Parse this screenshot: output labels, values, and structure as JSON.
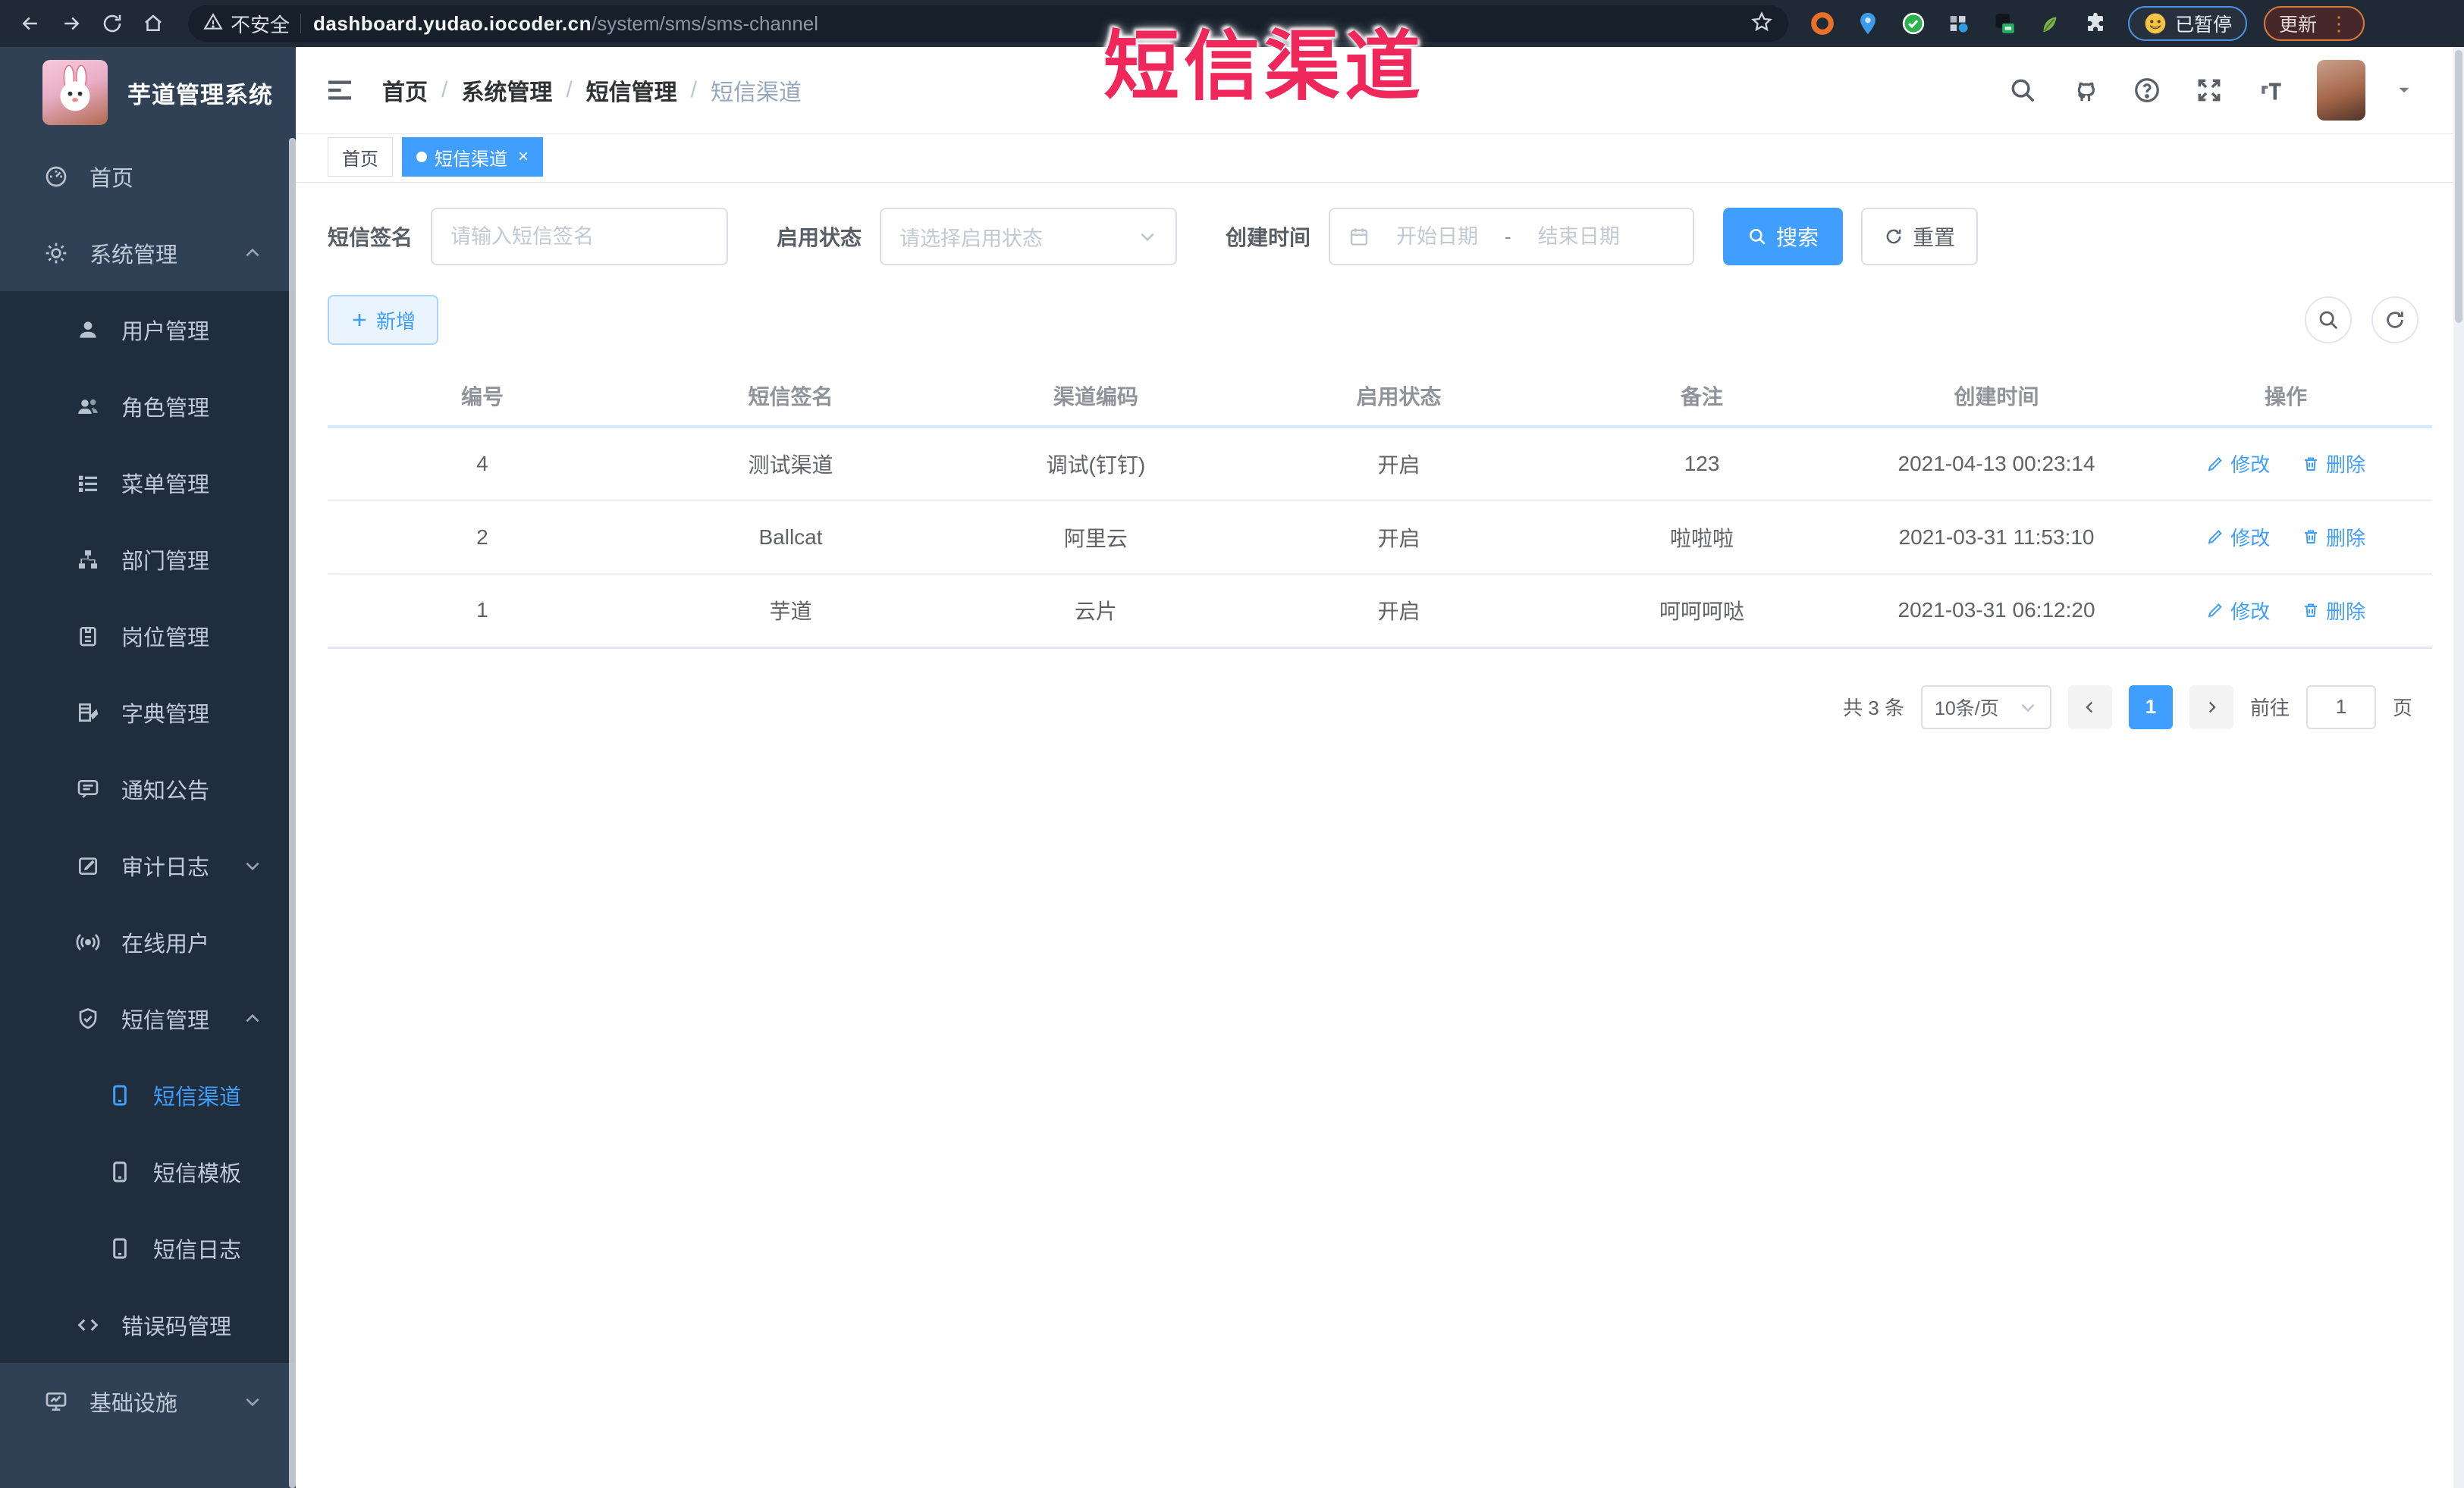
{
  "overlay": {
    "title": "短信渠道"
  },
  "browser": {
    "security_label": "不安全",
    "url_domain": "dashboard.yudao.iocoder.cn",
    "url_path": "/system/sms/sms-channel",
    "paused_label": "已暂停",
    "update_label": "更新",
    "menu_dots": "⋮"
  },
  "sidebar": {
    "logo_title": "芋道管理系统",
    "items": [
      {
        "label": "首页"
      },
      {
        "label": "系统管理",
        "expanded": true
      },
      {
        "label": "用户管理"
      },
      {
        "label": "角色管理"
      },
      {
        "label": "菜单管理"
      },
      {
        "label": "部门管理"
      },
      {
        "label": "岗位管理"
      },
      {
        "label": "字典管理"
      },
      {
        "label": "通知公告"
      },
      {
        "label": "审计日志",
        "expanded": false
      },
      {
        "label": "在线用户"
      },
      {
        "label": "短信管理",
        "expanded": true
      },
      {
        "label": "短信渠道",
        "active": true
      },
      {
        "label": "短信模板"
      },
      {
        "label": "短信日志"
      },
      {
        "label": "错误码管理"
      },
      {
        "label": "基础设施",
        "expanded": false
      }
    ]
  },
  "navbar": {
    "separator": "/",
    "breadcrumbs": [
      "首页",
      "系统管理",
      "短信管理",
      "短信渠道"
    ]
  },
  "tabs": [
    {
      "label": "首页",
      "active": false
    },
    {
      "label": "短信渠道",
      "active": true,
      "close_glyph": "×"
    }
  ],
  "filters": {
    "sign_label": "短信签名",
    "sign_placeholder": "请输入短信签名",
    "status_label": "启用状态",
    "status_placeholder": "请选择启用状态",
    "time_label": "创建时间",
    "date_start_placeholder": "开始日期",
    "date_separator": "-",
    "date_end_placeholder": "结束日期",
    "search_label": "搜索",
    "reset_label": "重置"
  },
  "toolbar": {
    "add_label": "新增"
  },
  "table": {
    "headers": [
      "编号",
      "短信签名",
      "渠道编码",
      "启用状态",
      "备注",
      "创建时间",
      "操作"
    ],
    "rows": [
      {
        "id": "4",
        "sign": "测试渠道",
        "code": "调试(钉钉)",
        "status": "开启",
        "remark": "123",
        "created": "2021-04-13 00:23:14"
      },
      {
        "id": "2",
        "sign": "Ballcat",
        "code": "阿里云",
        "status": "开启",
        "remark": "啦啦啦",
        "created": "2021-03-31 11:53:10"
      },
      {
        "id": "1",
        "sign": "芋道",
        "code": "云片",
        "status": "开启",
        "remark": "呵呵呵哒",
        "created": "2021-03-31 06:12:20"
      }
    ],
    "actions": {
      "edit": "修改",
      "delete": "删除"
    }
  },
  "pagination": {
    "total": "共 3 条",
    "page_size": "10条/页",
    "current_page": "1",
    "goto_label": "前往",
    "goto_value": "1",
    "page_unit": "页"
  },
  "colors": {
    "accent": "#409eff",
    "sidebar_bg": "#304156",
    "submenu_bg": "#1f2d3d",
    "chrome_bg": "#202a36",
    "overlay_red": "#f0275a",
    "header_divider": "#d2e9fa"
  },
  "icons": [
    "back-icon",
    "forward-icon",
    "reload-icon",
    "home-icon",
    "warning-icon",
    "star-icon",
    "extensions-puzzle-icon",
    "emoji-face-icon",
    "hamburger-icon",
    "search-icon",
    "github-icon",
    "question-icon",
    "fullscreen-icon",
    "font-size-icon",
    "chevron-down-icon",
    "dashboard-icon",
    "gear-icon",
    "user-icon",
    "users-icon",
    "list-icon",
    "tree-icon",
    "badge-icon",
    "book-icon",
    "megaphone-icon",
    "edit-log-icon",
    "broadcast-icon",
    "shield-icon",
    "phone-doc-icon",
    "code-icon",
    "monitor-icon",
    "plus-icon",
    "refresh-icon",
    "calendar-icon",
    "pencil-icon",
    "trash-icon",
    "chevron-left-icon",
    "chevron-right-icon"
  ]
}
